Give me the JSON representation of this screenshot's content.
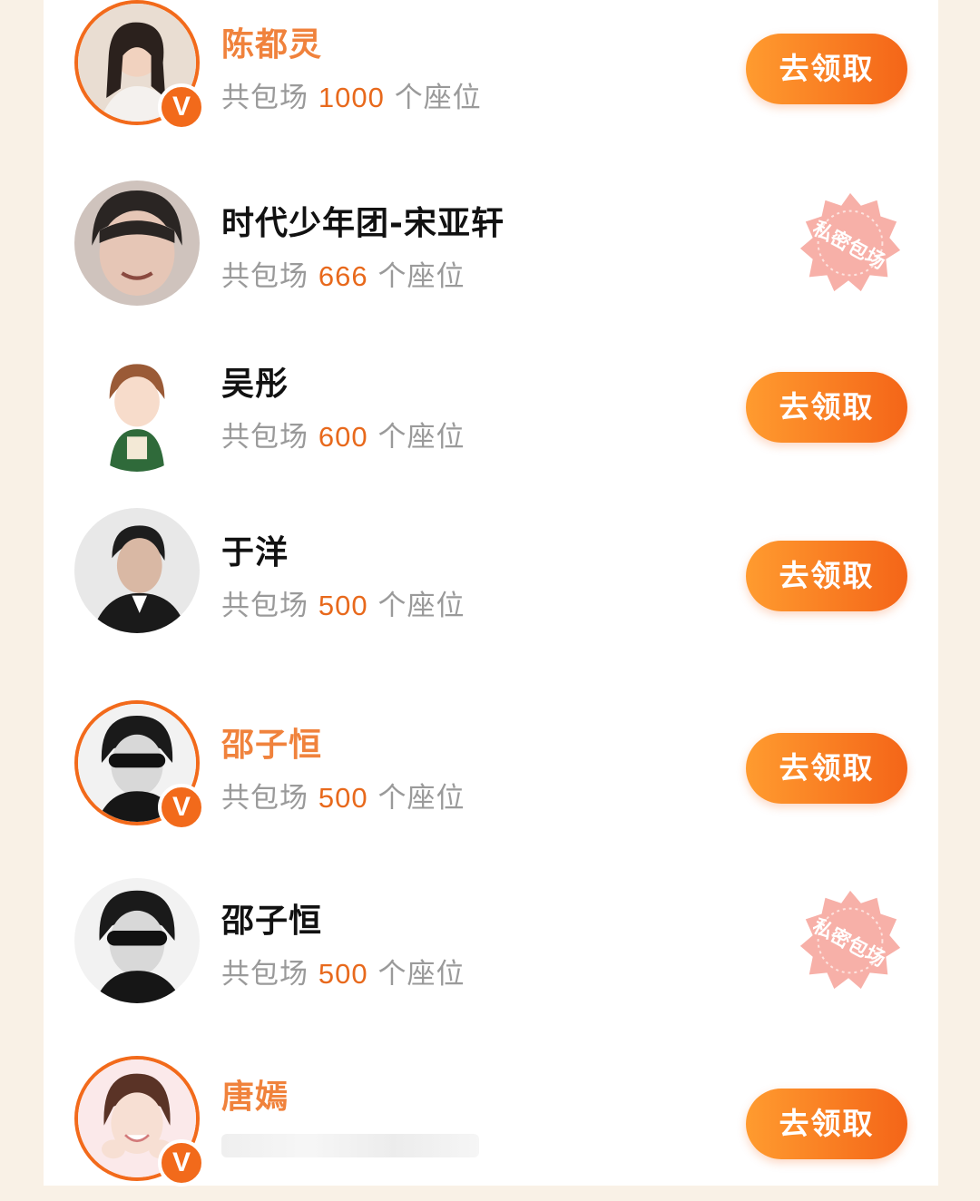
{
  "rows": [
    {
      "name": "陈都灵",
      "prefix": "共包场",
      "count": "1000",
      "suffix": "个座位",
      "action": "去领取"
    },
    {
      "name": "时代少年团-宋亚轩",
      "prefix": "共包场",
      "count": "666",
      "suffix": "个座位",
      "stamp": "私密包场"
    },
    {
      "name": "吴彤",
      "prefix": "共包场",
      "count": "600",
      "suffix": "个座位",
      "action": "去领取"
    },
    {
      "name": "于洋",
      "prefix": "共包场",
      "count": "500",
      "suffix": "个座位",
      "action": "去领取"
    },
    {
      "name": "邵子恒",
      "prefix": "共包场",
      "count": "500",
      "suffix": "个座位",
      "action": "去领取"
    },
    {
      "name": "邵子恒",
      "prefix": "共包场",
      "count": "500",
      "suffix": "个座位",
      "stamp": "私密包场"
    },
    {
      "name": "唐嫣",
      "action": "去领取"
    }
  ],
  "badge": {
    "vip": "V"
  },
  "colors": {
    "accent": "#f26a1b",
    "vip_name": "#f0823c",
    "count": "#e8691c",
    "stamp": "#f7b0a8"
  }
}
